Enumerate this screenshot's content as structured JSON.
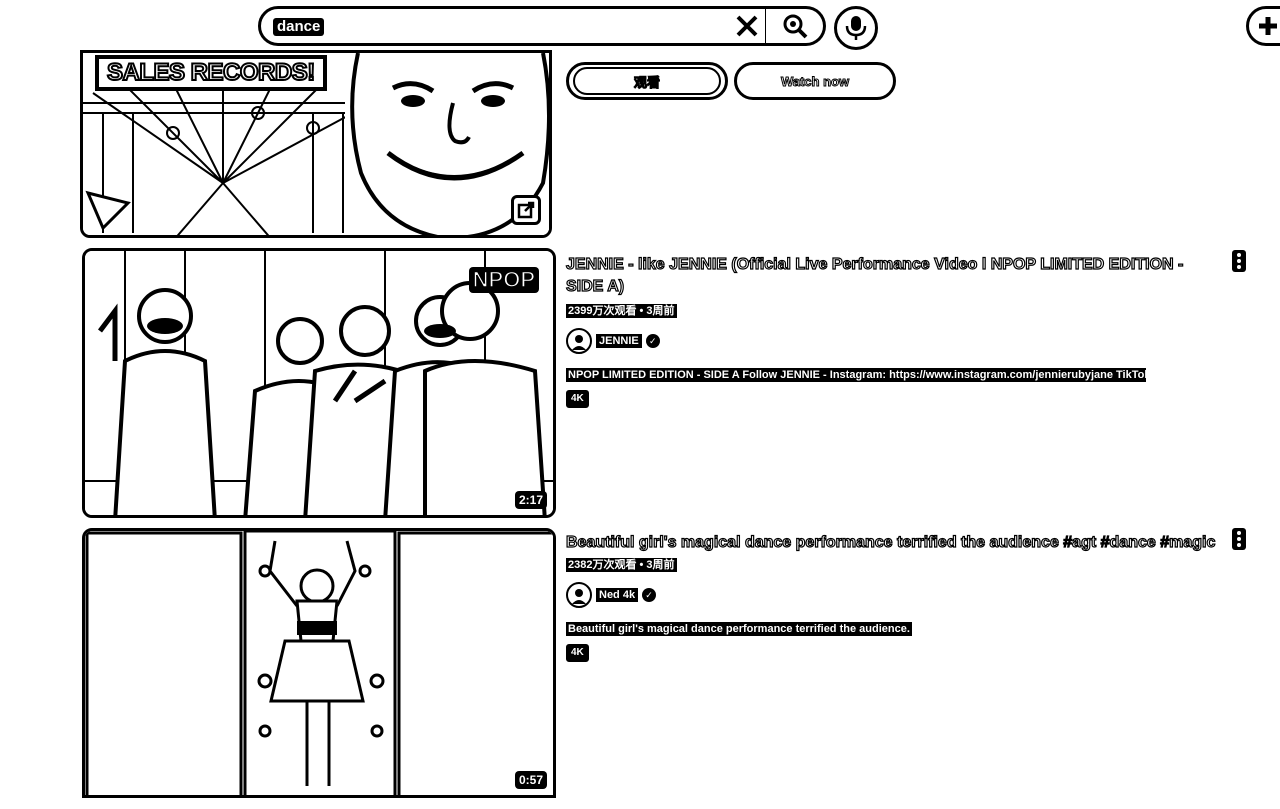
{
  "search": {
    "query": "dance"
  },
  "ad": {
    "banner_text": "SALES RECORDS!",
    "watch_label_cn": "观看",
    "watch_now_label": "Watch now"
  },
  "videos": [
    {
      "title": "JENNIE - like JENNIE (Official Live Performance Video l NPOP LIMITED EDITION - SIDE A)",
      "meta": "2399万次观看 • 3周前",
      "channel": "JENNIE",
      "description": "NPOP LIMITED EDITION - SIDE A Follow JENNIE - Instagram: https://www.instagram.com/jennierubyjane TikTok: ...",
      "badge": "4K",
      "duration": "2:17",
      "thumb_logo": "NPOP"
    },
    {
      "title": "Beautiful girl's magical dance performance terrified the audience #agt #dance #magic",
      "meta": "2382万次观看 • 3周前",
      "channel": "Ned 4k",
      "description": "Beautiful girl's magical dance performance terrified the audience.",
      "badge": "4K",
      "duration": "0:57"
    }
  ]
}
